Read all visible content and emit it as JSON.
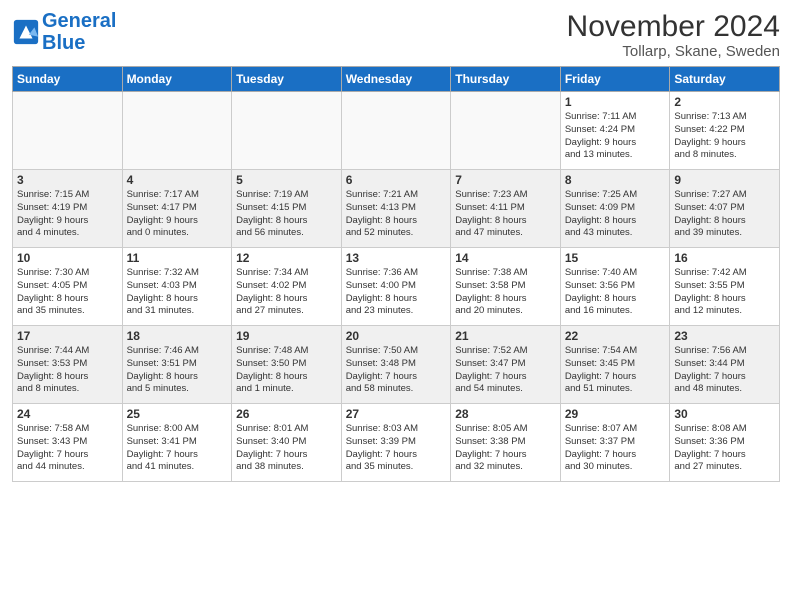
{
  "header": {
    "logo_line1": "General",
    "logo_line2": "Blue",
    "month": "November 2024",
    "location": "Tollarp, Skane, Sweden"
  },
  "days_of_week": [
    "Sunday",
    "Monday",
    "Tuesday",
    "Wednesday",
    "Thursday",
    "Friday",
    "Saturday"
  ],
  "weeks": [
    [
      {
        "day": "",
        "info": "",
        "empty": true
      },
      {
        "day": "",
        "info": "",
        "empty": true
      },
      {
        "day": "",
        "info": "",
        "empty": true
      },
      {
        "day": "",
        "info": "",
        "empty": true
      },
      {
        "day": "",
        "info": "",
        "empty": true
      },
      {
        "day": "1",
        "info": "Sunrise: 7:11 AM\nSunset: 4:24 PM\nDaylight: 9 hours\nand 13 minutes."
      },
      {
        "day": "2",
        "info": "Sunrise: 7:13 AM\nSunset: 4:22 PM\nDaylight: 9 hours\nand 8 minutes."
      }
    ],
    [
      {
        "day": "3",
        "info": "Sunrise: 7:15 AM\nSunset: 4:19 PM\nDaylight: 9 hours\nand 4 minutes."
      },
      {
        "day": "4",
        "info": "Sunrise: 7:17 AM\nSunset: 4:17 PM\nDaylight: 9 hours\nand 0 minutes."
      },
      {
        "day": "5",
        "info": "Sunrise: 7:19 AM\nSunset: 4:15 PM\nDaylight: 8 hours\nand 56 minutes."
      },
      {
        "day": "6",
        "info": "Sunrise: 7:21 AM\nSunset: 4:13 PM\nDaylight: 8 hours\nand 52 minutes."
      },
      {
        "day": "7",
        "info": "Sunrise: 7:23 AM\nSunset: 4:11 PM\nDaylight: 8 hours\nand 47 minutes."
      },
      {
        "day": "8",
        "info": "Sunrise: 7:25 AM\nSunset: 4:09 PM\nDaylight: 8 hours\nand 43 minutes."
      },
      {
        "day": "9",
        "info": "Sunrise: 7:27 AM\nSunset: 4:07 PM\nDaylight: 8 hours\nand 39 minutes."
      }
    ],
    [
      {
        "day": "10",
        "info": "Sunrise: 7:30 AM\nSunset: 4:05 PM\nDaylight: 8 hours\nand 35 minutes."
      },
      {
        "day": "11",
        "info": "Sunrise: 7:32 AM\nSunset: 4:03 PM\nDaylight: 8 hours\nand 31 minutes."
      },
      {
        "day": "12",
        "info": "Sunrise: 7:34 AM\nSunset: 4:02 PM\nDaylight: 8 hours\nand 27 minutes."
      },
      {
        "day": "13",
        "info": "Sunrise: 7:36 AM\nSunset: 4:00 PM\nDaylight: 8 hours\nand 23 minutes."
      },
      {
        "day": "14",
        "info": "Sunrise: 7:38 AM\nSunset: 3:58 PM\nDaylight: 8 hours\nand 20 minutes."
      },
      {
        "day": "15",
        "info": "Sunrise: 7:40 AM\nSunset: 3:56 PM\nDaylight: 8 hours\nand 16 minutes."
      },
      {
        "day": "16",
        "info": "Sunrise: 7:42 AM\nSunset: 3:55 PM\nDaylight: 8 hours\nand 12 minutes."
      }
    ],
    [
      {
        "day": "17",
        "info": "Sunrise: 7:44 AM\nSunset: 3:53 PM\nDaylight: 8 hours\nand 8 minutes."
      },
      {
        "day": "18",
        "info": "Sunrise: 7:46 AM\nSunset: 3:51 PM\nDaylight: 8 hours\nand 5 minutes."
      },
      {
        "day": "19",
        "info": "Sunrise: 7:48 AM\nSunset: 3:50 PM\nDaylight: 8 hours\nand 1 minute."
      },
      {
        "day": "20",
        "info": "Sunrise: 7:50 AM\nSunset: 3:48 PM\nDaylight: 7 hours\nand 58 minutes."
      },
      {
        "day": "21",
        "info": "Sunrise: 7:52 AM\nSunset: 3:47 PM\nDaylight: 7 hours\nand 54 minutes."
      },
      {
        "day": "22",
        "info": "Sunrise: 7:54 AM\nSunset: 3:45 PM\nDaylight: 7 hours\nand 51 minutes."
      },
      {
        "day": "23",
        "info": "Sunrise: 7:56 AM\nSunset: 3:44 PM\nDaylight: 7 hours\nand 48 minutes."
      }
    ],
    [
      {
        "day": "24",
        "info": "Sunrise: 7:58 AM\nSunset: 3:43 PM\nDaylight: 7 hours\nand 44 minutes."
      },
      {
        "day": "25",
        "info": "Sunrise: 8:00 AM\nSunset: 3:41 PM\nDaylight: 7 hours\nand 41 minutes."
      },
      {
        "day": "26",
        "info": "Sunrise: 8:01 AM\nSunset: 3:40 PM\nDaylight: 7 hours\nand 38 minutes."
      },
      {
        "day": "27",
        "info": "Sunrise: 8:03 AM\nSunset: 3:39 PM\nDaylight: 7 hours\nand 35 minutes."
      },
      {
        "day": "28",
        "info": "Sunrise: 8:05 AM\nSunset: 3:38 PM\nDaylight: 7 hours\nand 32 minutes."
      },
      {
        "day": "29",
        "info": "Sunrise: 8:07 AM\nSunset: 3:37 PM\nDaylight: 7 hours\nand 30 minutes."
      },
      {
        "day": "30",
        "info": "Sunrise: 8:08 AM\nSunset: 3:36 PM\nDaylight: 7 hours\nand 27 minutes."
      }
    ]
  ]
}
